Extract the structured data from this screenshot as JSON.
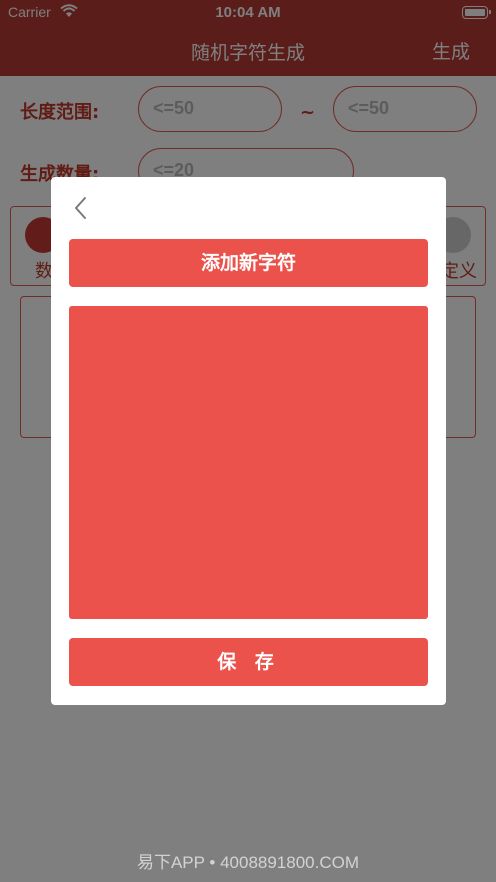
{
  "status_bar": {
    "carrier": "Carrier",
    "time": "10:04 AM"
  },
  "nav": {
    "title": "随机字符生成",
    "generate": "生成"
  },
  "form": {
    "length_label": "长度范围:",
    "length_min": "<=50",
    "tilde": "~",
    "length_max": "<=50",
    "count_label": "生成数量:",
    "count_value": "<=20",
    "segment_left": "数",
    "segment_right": "定义"
  },
  "dialog": {
    "add_button": "添加新字符",
    "save_button": "保 存"
  },
  "watermark": "易下APP • 4008891800.COM",
  "colors": {
    "primary": "#b53a35",
    "accent": "#ea524b"
  }
}
